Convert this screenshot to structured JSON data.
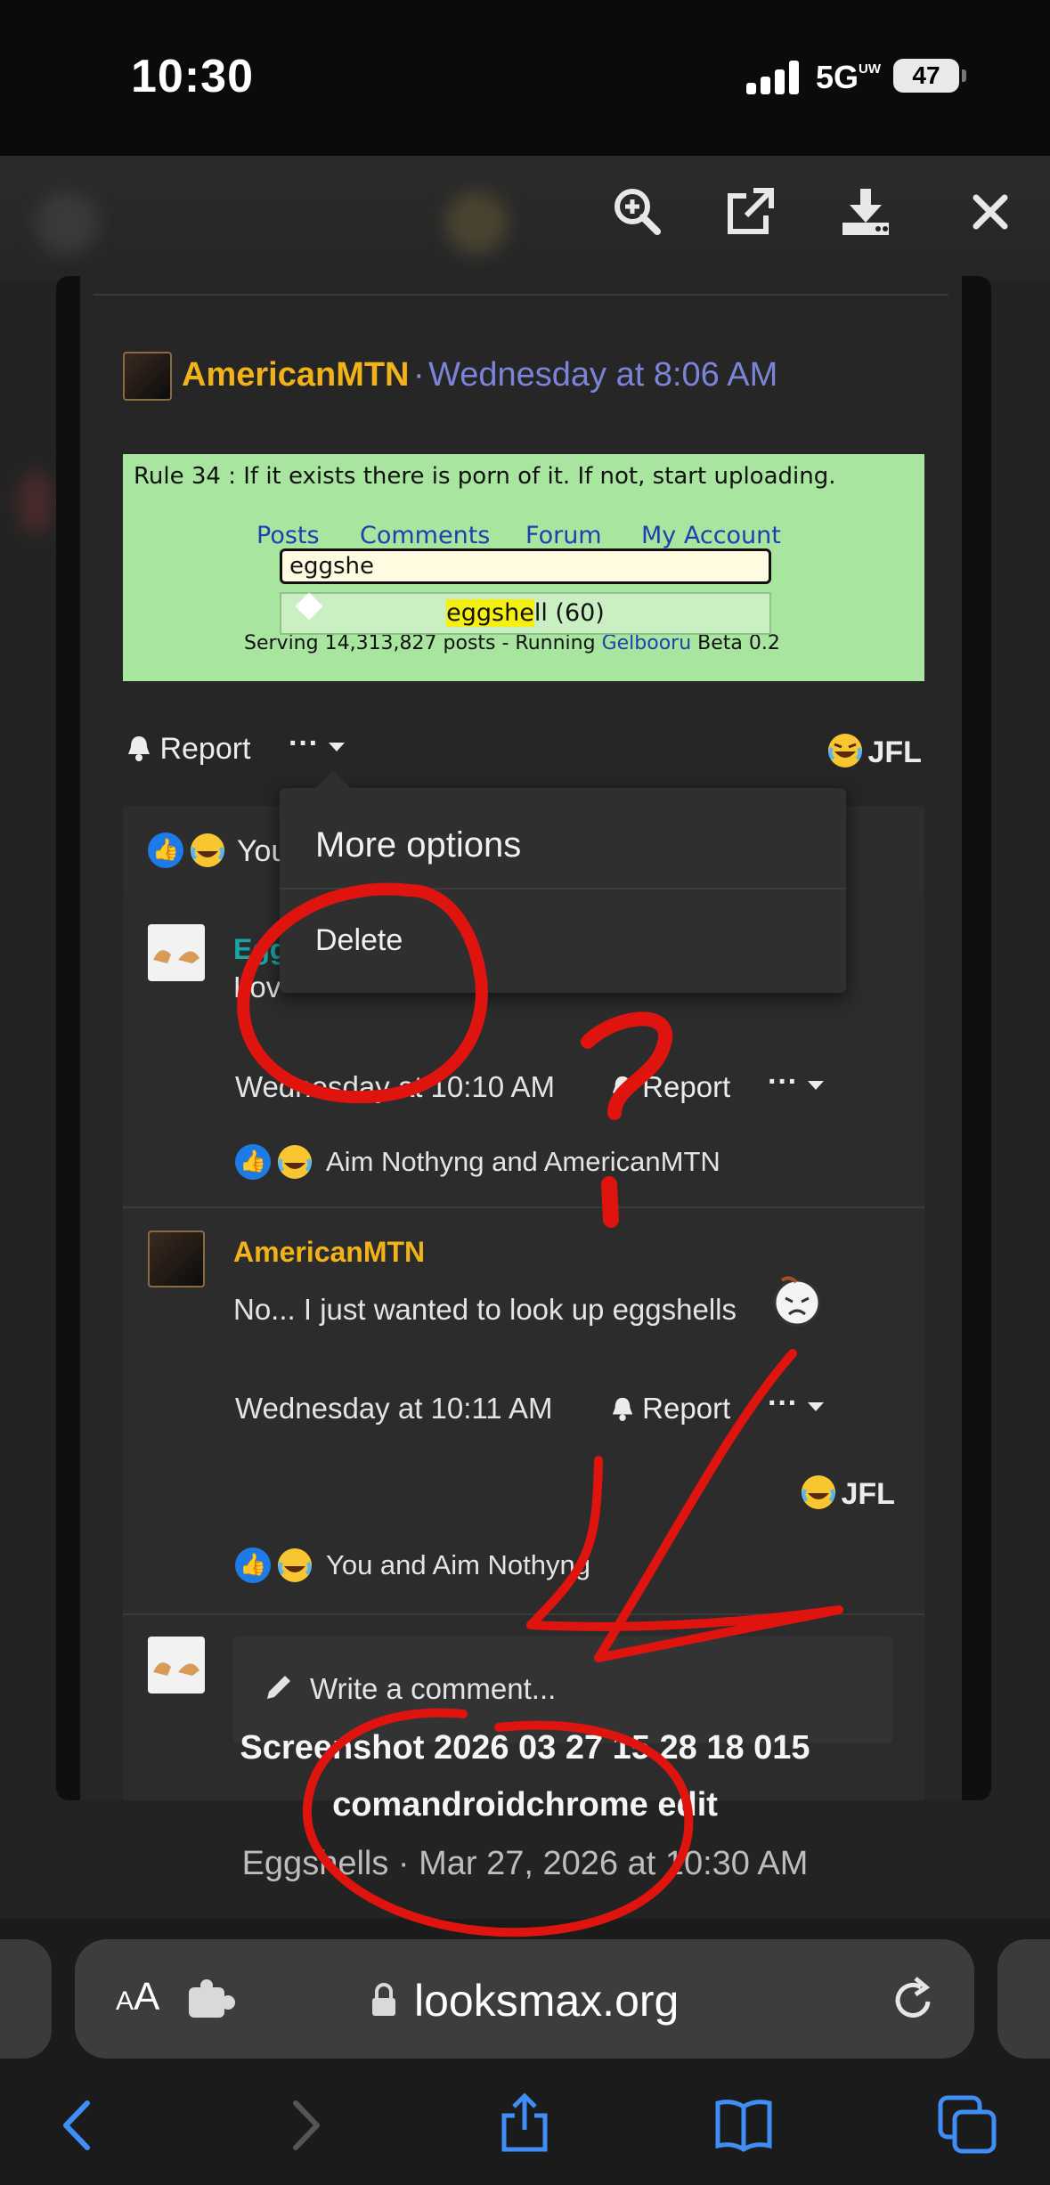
{
  "status_bar": {
    "time": "10:30",
    "network": "5G",
    "network_sup": "UW",
    "battery": "47"
  },
  "viewer_toolbar": {
    "icons": [
      "zoom-in-icon",
      "open-external-icon",
      "download-icon",
      "close-icon"
    ]
  },
  "post": {
    "author": "AmericanMTN",
    "separator": "·",
    "date": "Wednesday at 8:06 AM",
    "embedded_image": {
      "rule_text": "Rule 34 : If it exists there is porn of it. If not, start uploading.",
      "nav_links": [
        "Posts",
        "Comments",
        "Forum",
        "My Account"
      ],
      "search_value": "eggshe",
      "suggestion_highlight": "eggshe",
      "suggestion_rest": "ll (60)",
      "serving_prefix": "Serving 14,313,827 posts - Running",
      "serving_link": "Gelbooru",
      "serving_suffix": "Beta 0.2"
    },
    "report_label": "Report",
    "more_label": "···",
    "reaction_label": "JFL",
    "reactions_prefix": "You"
  },
  "menu": {
    "title": "More options",
    "delete_label": "Delete"
  },
  "comments": [
    {
      "name_partial": "Egg",
      "body_partial": "Lov",
      "meta_date": "Wednesday at 10:10 AM",
      "report_label": "Report",
      "more_label": "···",
      "reactions": "Aim Nothyng and AmericanMTN"
    },
    {
      "name": "AmericanMTN",
      "body": "No... I just wanted to look up eggshells",
      "meta_date": "Wednesday at 10:11 AM",
      "report_label": "Report",
      "more_label": "···",
      "reaction_label": "JFL",
      "reactions": "You and Aim Nothyng"
    }
  ],
  "write_comment_placeholder": "Write a comment...",
  "caption": {
    "line1": "Screenshot 2026 03 27 15 28 18 015",
    "line2": "comandroidchrome edit",
    "line3": "Eggshells · Mar 27, 2026 at 10:30 AM"
  },
  "safari": {
    "text_size_small": "A",
    "text_size_large": "A",
    "url": "looksmax.org"
  },
  "colors": {
    "username": "#f2b31a",
    "date": "#7b84d8",
    "annotation_red": "#e0140f",
    "like_blue": "#1d7be8"
  }
}
